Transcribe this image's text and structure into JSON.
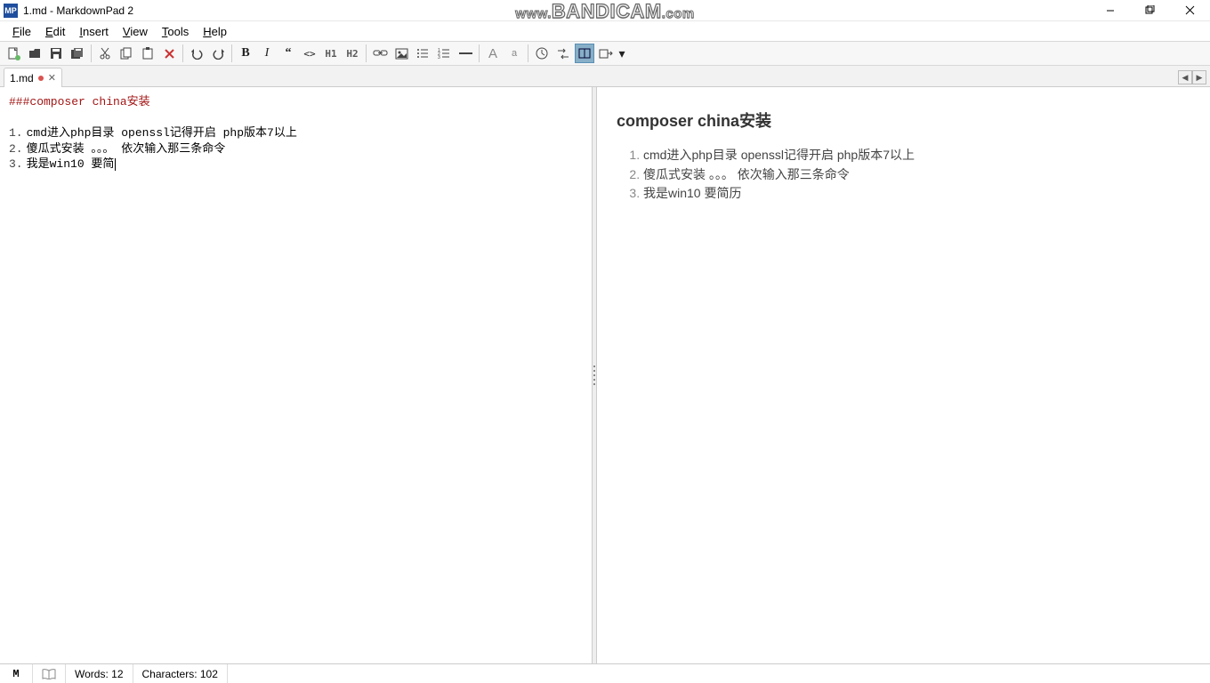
{
  "window": {
    "app_icon_text": "MP",
    "title": "1.md - MarkdownPad 2"
  },
  "menu": {
    "file": "File",
    "edit": "Edit",
    "insert": "Insert",
    "view": "View",
    "tools": "Tools",
    "help": "Help"
  },
  "toolbar": {
    "h1": "H1",
    "h2": "H2",
    "font_big": "A",
    "font_small": "a"
  },
  "tab": {
    "label": "1.md"
  },
  "editor": {
    "heading": "###composer china安装",
    "lines": [
      {
        "num": "1.",
        "text": "cmd进入php目录   openssl记得开启  php版本7以上"
      },
      {
        "num": "2.",
        "text": "傻瓜式安装 。。。  依次输入那三条命令"
      },
      {
        "num": "3.",
        "text": "我是win10 要简"
      }
    ]
  },
  "preview": {
    "heading": "composer china安装",
    "items": [
      "cmd进入php目录 openssl记得开启 php版本7以上",
      "傻瓜式安装 。。。 依次输入那三条命令",
      "我是win10 要简历"
    ]
  },
  "status": {
    "words_label": "Words:",
    "words_value": "12",
    "chars_label": "Characters:",
    "chars_value": "102"
  },
  "watermark": {
    "prefix": "www.",
    "main": "BANDICAM",
    "suffix": ".com"
  }
}
